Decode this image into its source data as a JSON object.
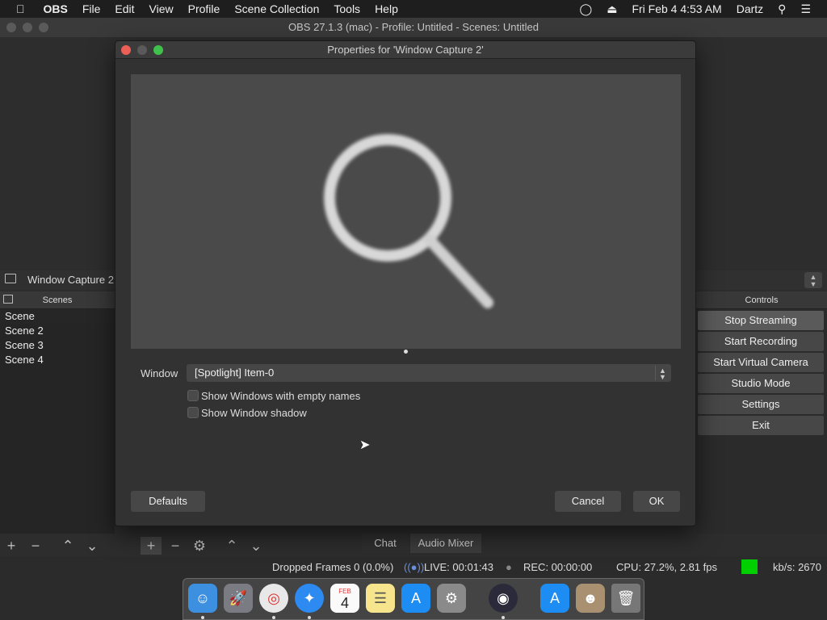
{
  "menubar": {
    "items": [
      "OBS",
      "File",
      "Edit",
      "View",
      "Profile",
      "Scene Collection",
      "Tools",
      "Help"
    ],
    "datetime": "Fri Feb 4  4:53 AM",
    "user": "Dartz"
  },
  "window": {
    "title": "OBS 27.1.3 (mac) - Profile: Untitled - Scenes: Untitled"
  },
  "source_bar": {
    "label": "Window Capture 2"
  },
  "scenes": {
    "header": "Scenes",
    "items": [
      "Scene",
      "Scene 2",
      "Scene 3",
      "Scene 4"
    ]
  },
  "controls": {
    "header": "Controls",
    "buttons": [
      "Stop Streaming",
      "Start Recording",
      "Start Virtual Camera",
      "Studio Mode",
      "Settings",
      "Exit"
    ]
  },
  "tabs": {
    "chat": "Chat",
    "mixer": "Audio Mixer"
  },
  "status": {
    "dropped": "Dropped Frames 0 (0.0%)",
    "live": "LIVE: 00:01:43",
    "rec": "REC: 00:00:00",
    "cpu": "CPU: 27.2%, 2.81 fps",
    "kbs": "kb/s: 2670",
    "indicator_color": "#00d000"
  },
  "dialog": {
    "title": "Properties for 'Window Capture 2'",
    "window_label": "Window",
    "window_value": "[Spotlight] Item-0",
    "opt_empty_names": "Show Windows with empty names",
    "opt_shadow": "Show Window shadow",
    "defaults": "Defaults",
    "cancel": "Cancel",
    "ok": "OK"
  },
  "dock": {
    "icons": [
      "finder-icon",
      "launchpad-icon",
      "chrome-icon",
      "safari-icon",
      "calendar-icon",
      "notes-icon",
      "app-store-icon",
      "system-preferences-icon",
      "obs-icon",
      "app-store-folder-icon",
      "photo-folder-icon",
      "trash-icon"
    ],
    "calendar_month": "FEB",
    "calendar_day": "4"
  }
}
